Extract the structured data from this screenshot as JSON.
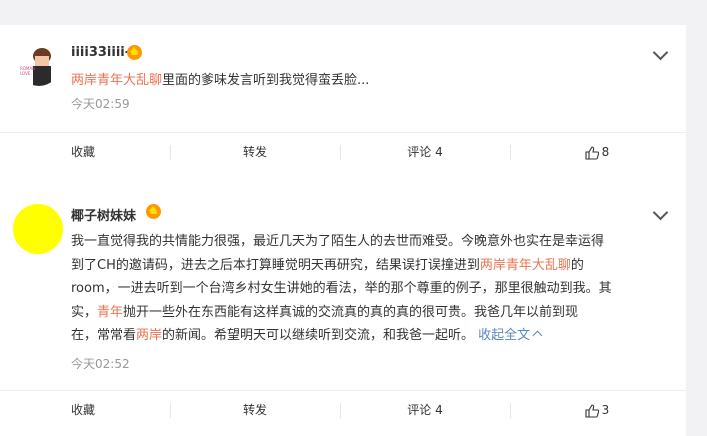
{
  "posts": [
    {
      "username": "iiii33iiii-",
      "content": [
        {
          "t": "两岸青年大乱聊",
          "link": true
        },
        {
          "t": "里面的爹味发言听到我觉得蛮丢脸..."
        }
      ],
      "time": "今天02:59",
      "actions": {
        "collect": "收藏",
        "repost": "转发",
        "comment": "评论 4",
        "like": "8"
      }
    },
    {
      "username": "椰子树妹妹",
      "content_lines": [
        [
          {
            "t": "我一直觉得我的共情能力很强，最近几天为了陌生人的去世而难受。今晚意外也实在是幸运得"
          }
        ],
        [
          {
            "t": "到了CH的邀请码，进去之后本打算睡觉明天再研究，结果误打误撞进到"
          },
          {
            "t": "两岸青年大乱聊",
            "link": true
          },
          {
            "t": "的"
          }
        ],
        [
          {
            "t": "room，一进去听到一个台湾乡村女生讲她的看法，举的那个尊重的例子，那里很触动到我。其"
          }
        ],
        [
          {
            "t": "实，"
          },
          {
            "t": "青年",
            "link": true
          },
          {
            "t": "抛开一些外在东西能有这样真诚的交流真的真的真的很可贵。我爸几年以前到现"
          }
        ],
        [
          {
            "t": "在，常常看"
          },
          {
            "t": "两岸",
            "link": true
          },
          {
            "t": "的新闻。希望明天可以继续听到交流，和我爸一起听。"
          },
          {
            "t": "  收起全文",
            "fold": true
          }
        ]
      ],
      "time": "今天02:52",
      "actions": {
        "collect": "收藏",
        "repost": "转发",
        "comment": "评论 4",
        "like": "3"
      }
    }
  ],
  "colors": {
    "link": "#eb7350",
    "blue": "#5b87c1",
    "badge": "#ff9800",
    "avatar2": "#ffff00"
  }
}
